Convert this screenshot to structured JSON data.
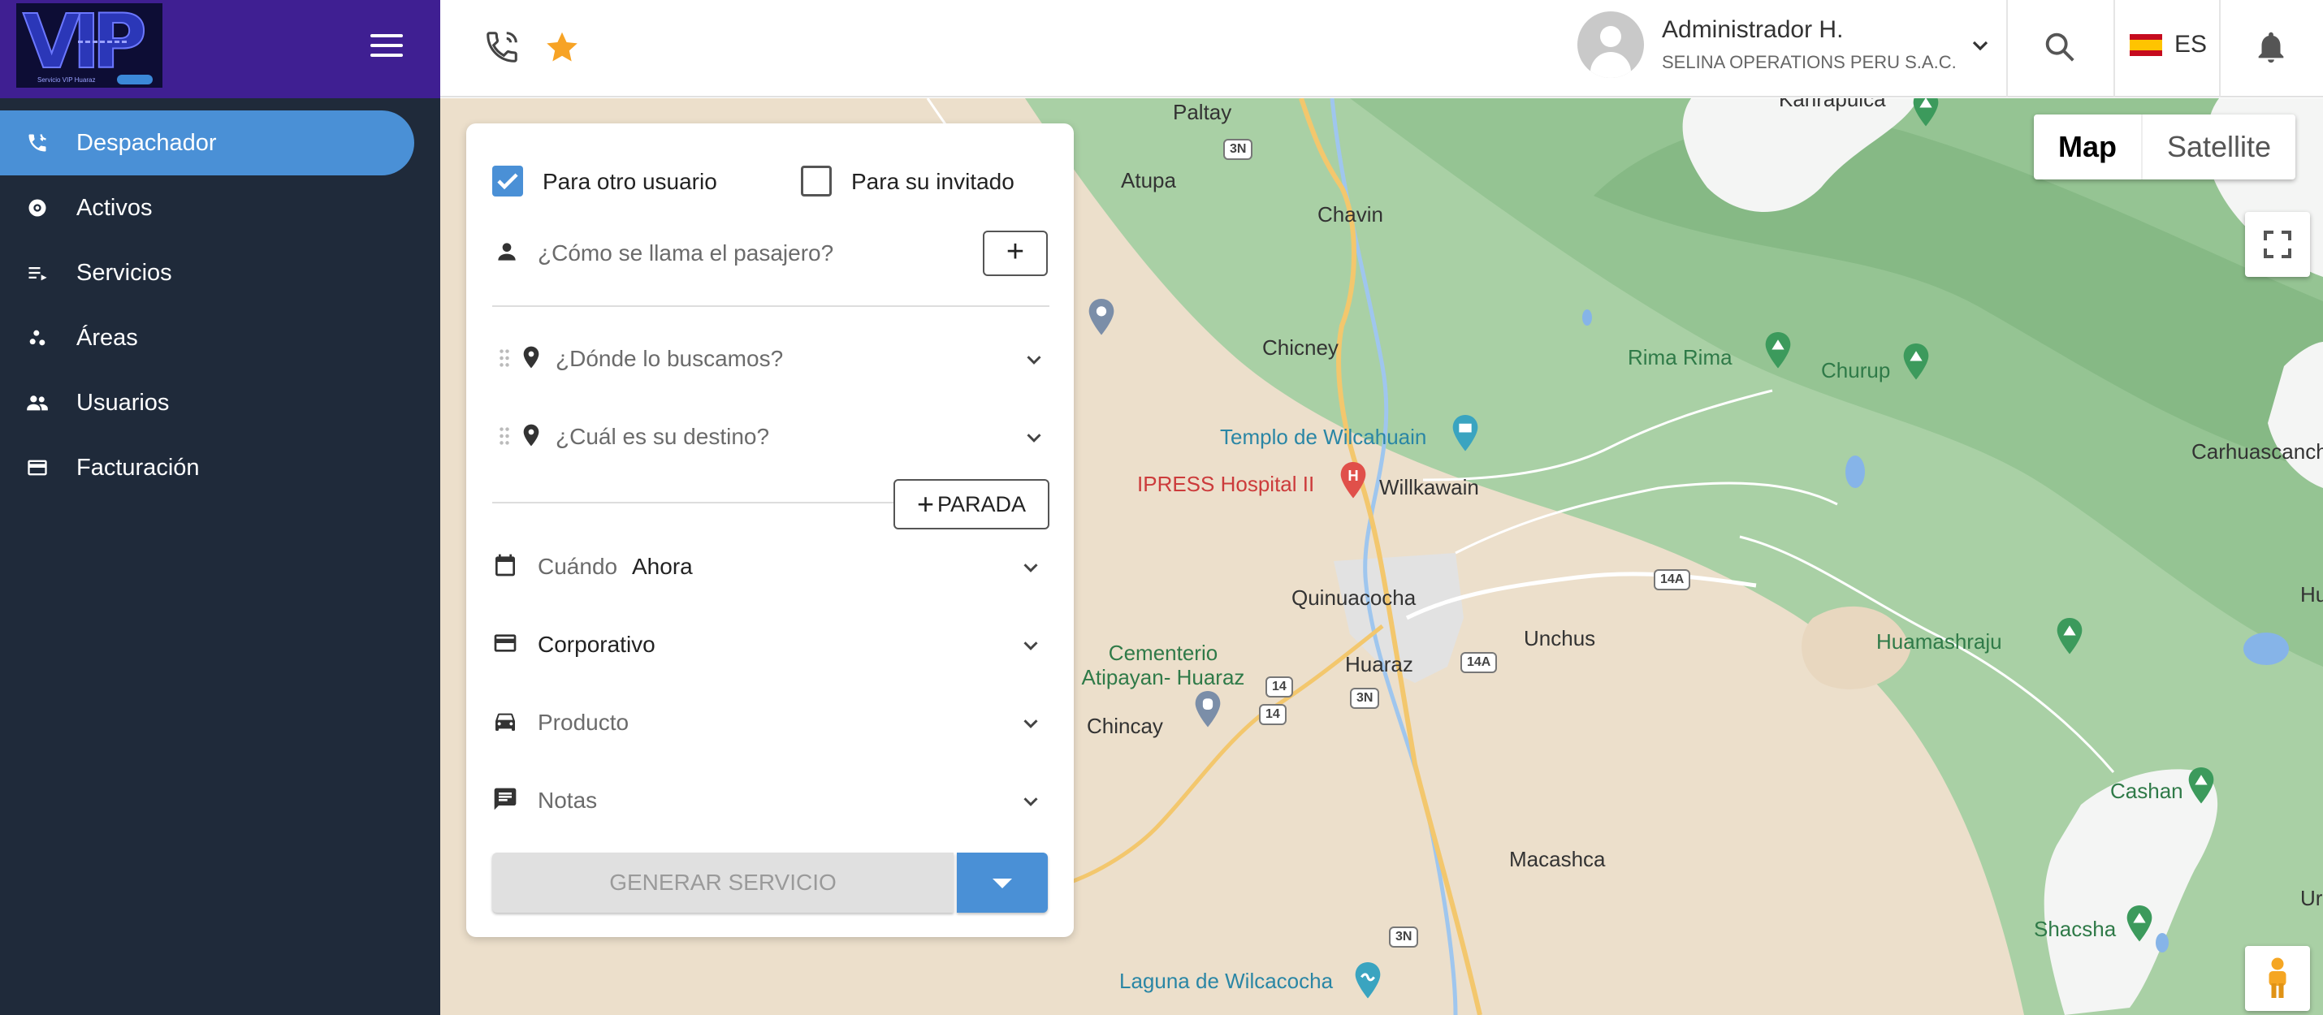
{
  "sidebar": {
    "logo_text": "VIP",
    "logo_subtext": "Servicio VIP Huaraz",
    "items": [
      {
        "label": "Despachador",
        "icon": "phone-in-talk-icon",
        "active": true
      },
      {
        "label": "Activos",
        "icon": "radar-icon"
      },
      {
        "label": "Servicios",
        "icon": "list-icon"
      },
      {
        "label": "Áreas",
        "icon": "scatter-icon"
      },
      {
        "label": "Usuarios",
        "icon": "people-icon"
      },
      {
        "label": "Facturación",
        "icon": "credit-card-icon"
      }
    ]
  },
  "topbar": {
    "call_icon": "phone-call-icon",
    "favorite_icon": "star-icon",
    "user_name": "Administrador H.",
    "user_company": "SELINA OPERATIONS PERU S.A.C.",
    "language": "ES",
    "colors": {
      "star": "#f7a325",
      "accent": "#4a90d6",
      "logo_bar": "#3f1f92",
      "sidebar": "#1f2a3a"
    }
  },
  "form": {
    "for_other_user": {
      "label": "Para otro usuario",
      "checked": true
    },
    "for_guest": {
      "label": "Para su invitado",
      "checked": false
    },
    "passenger_placeholder": "¿Cómo se llama el pasajero?",
    "add_passenger": "+",
    "pickup_placeholder": "¿Dónde lo buscamos?",
    "destination_placeholder": "¿Cuál es su destino?",
    "add_stop": "PARADA",
    "add_stop_plus": "+",
    "when_label": "Cuándo",
    "when_value": "Ahora",
    "payment_label": "Corporativo",
    "product_placeholder": "Producto",
    "notes_placeholder": "Notas",
    "generate_label": "GENERAR SERVICIO"
  },
  "map": {
    "type_options": [
      "Map",
      "Satellite"
    ],
    "selected_type": "Map",
    "places": [
      {
        "name": "Kanrapuica",
        "kind": "place"
      },
      {
        "name": "Paltay",
        "kind": "place"
      },
      {
        "name": "Atupa",
        "kind": "place"
      },
      {
        "name": "Chavin",
        "kind": "place"
      },
      {
        "name": "Chicney",
        "kind": "place"
      },
      {
        "name": "Rima Rima",
        "kind": "park"
      },
      {
        "name": "Churup",
        "kind": "park"
      },
      {
        "name": "Templo de Wilcahuain",
        "kind": "poi-blue"
      },
      {
        "name": "IPRESS Hospital II",
        "kind": "poi-red"
      },
      {
        "name": "Willkawain",
        "kind": "place"
      },
      {
        "name": "Carhuascancha",
        "kind": "place"
      },
      {
        "name": "Quinuacocha",
        "kind": "place"
      },
      {
        "name": "Unchus",
        "kind": "place"
      },
      {
        "name": "Huamashraju",
        "kind": "park"
      },
      {
        "name": "Cementerio Atipayan- Huaraz",
        "kind": "poi-green"
      },
      {
        "name": "Huaraz",
        "kind": "place"
      },
      {
        "name": "Chincay",
        "kind": "place"
      },
      {
        "name": "Macashca",
        "kind": "place"
      },
      {
        "name": "Cashan",
        "kind": "park"
      },
      {
        "name": "Shacsha",
        "kind": "park"
      },
      {
        "name": "Laguna de Wilcacocha",
        "kind": "poi-blue"
      },
      {
        "name": "Hu",
        "kind": "place"
      },
      {
        "name": "Uru",
        "kind": "place"
      }
    ],
    "road_shields": [
      "3N",
      "3N",
      "3N",
      "14",
      "14",
      "14A",
      "14A"
    ]
  }
}
